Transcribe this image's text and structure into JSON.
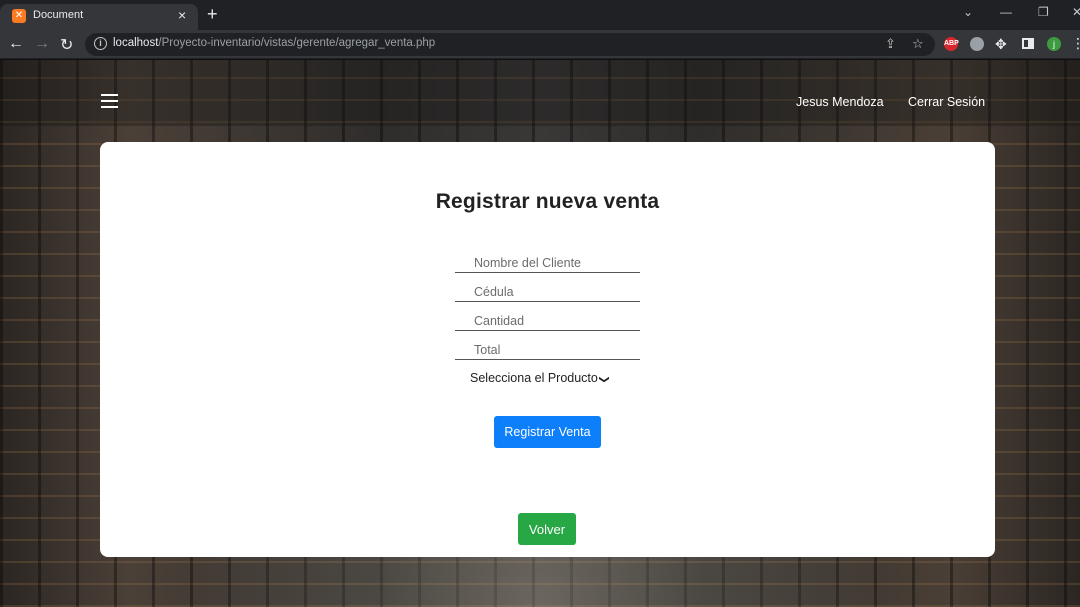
{
  "browser": {
    "tab_title": "Document",
    "tab_favicon": "xampp-icon",
    "tab_close": "×",
    "new_tab": "+",
    "url_host": "localhost",
    "url_path": "/Proyecto-inventario/vistas/gerente/agregar_venta.php",
    "extensions": [
      "ABP",
      "j"
    ]
  },
  "navbar": {
    "user_name": "Jesus Mendoza",
    "logout_label": "Cerrar Sesión"
  },
  "form": {
    "title": "Registrar nueva venta",
    "fields": {
      "client_placeholder": "Nombre del Cliente",
      "id_placeholder": "Cédula",
      "quantity_placeholder": "Cantidad",
      "total_placeholder": "Total"
    },
    "product_select_label": "Selecciona el Producto",
    "submit_label": "Registrar Venta",
    "back_label": "Volver"
  },
  "colors": {
    "primary": "#0d7ffb",
    "success": "#28a745"
  }
}
